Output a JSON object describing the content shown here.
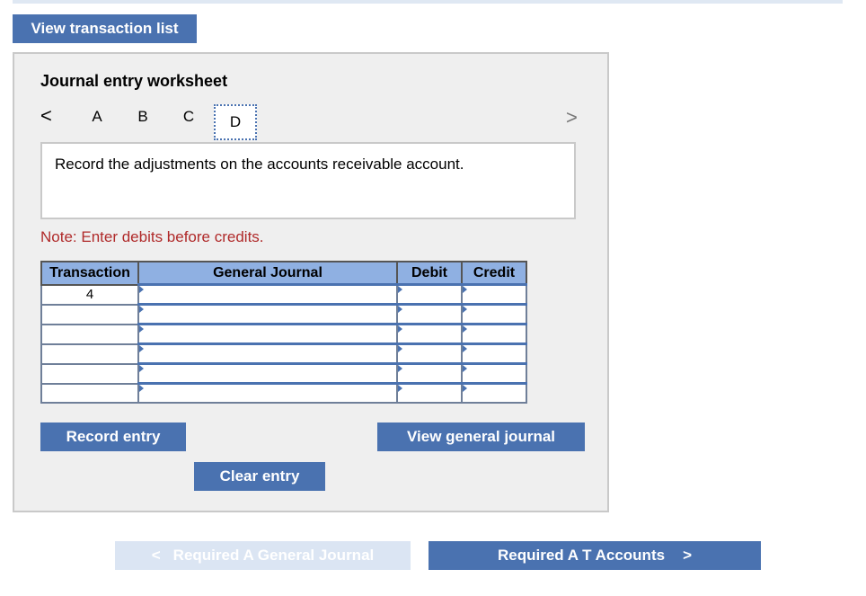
{
  "top": {
    "view_transaction_list": "View transaction list"
  },
  "worksheet": {
    "title": "Journal entry worksheet",
    "tabs": [
      "A",
      "B",
      "C",
      "D"
    ],
    "active_tab": "D",
    "prev_arrow": "<",
    "next_arrow": ">",
    "instruction": "Record the adjustments on the accounts receivable account.",
    "note": "Note: Enter debits before credits.",
    "table": {
      "headers": [
        "Transaction",
        "General Journal",
        "Debit",
        "Credit"
      ],
      "rows": [
        [
          "4",
          "",
          "",
          ""
        ],
        [
          "",
          "",
          "",
          ""
        ],
        [
          "",
          "",
          "",
          ""
        ],
        [
          "",
          "",
          "",
          ""
        ],
        [
          "",
          "",
          "",
          ""
        ],
        [
          "",
          "",
          "",
          ""
        ]
      ]
    },
    "record_entry": "Record entry",
    "view_general_journal": "View general journal",
    "clear_entry": "Clear entry"
  },
  "footer": {
    "prev_label": "Required A General Journal",
    "next_label": "Required A T Accounts",
    "prev_icon": "<",
    "next_icon": ">"
  },
  "colors": {
    "accent": "#4a72b0",
    "header": "#8fb0e2",
    "note": "#b02a2a",
    "disabled": "#dbe5f3"
  }
}
